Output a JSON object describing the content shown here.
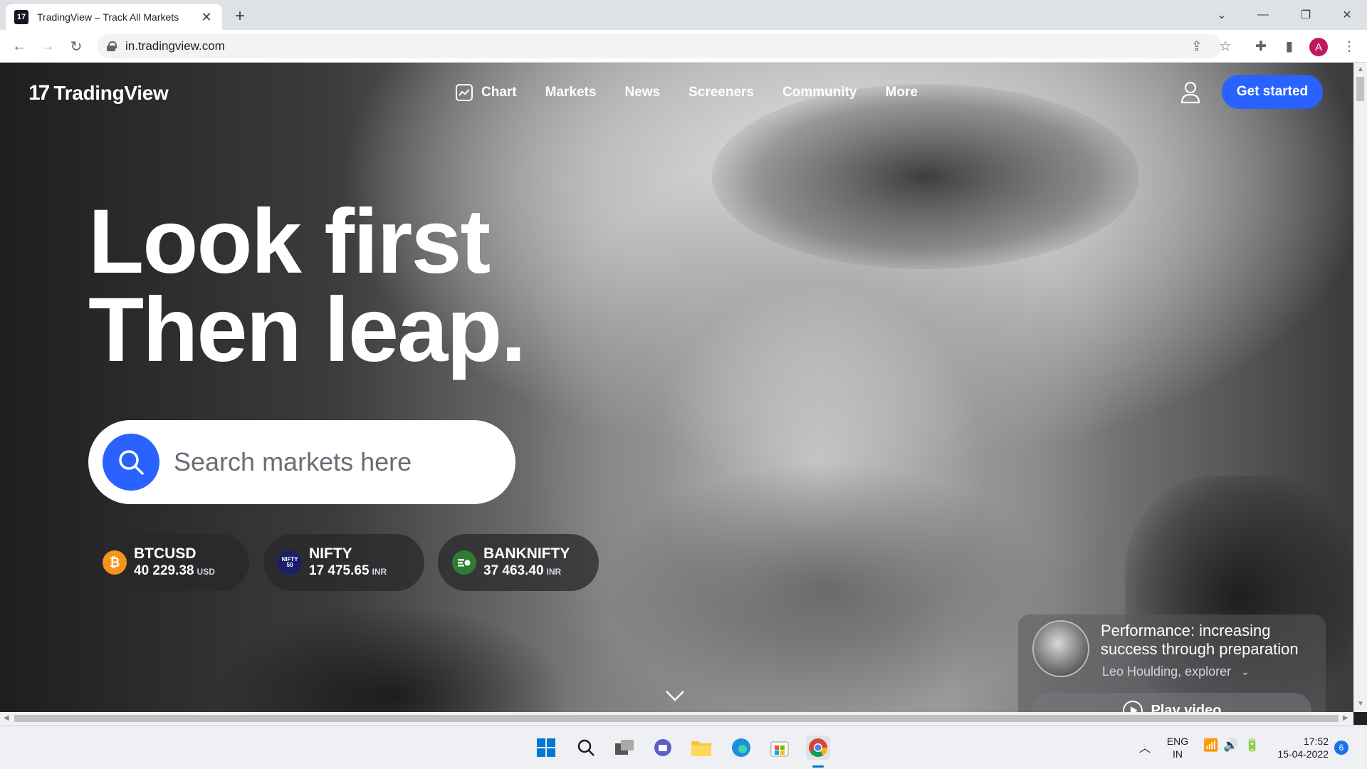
{
  "browser": {
    "tab_title": "TradingView – Track All Markets",
    "tab_favicon": "17",
    "url": "in.tradingview.com",
    "profile_initial": "A"
  },
  "site": {
    "logo_mark": "17",
    "logo_text": "TradingView",
    "nav": [
      "Chart",
      "Markets",
      "News",
      "Screeners",
      "Community",
      "More"
    ],
    "cta": "Get started"
  },
  "hero": {
    "line1": "Look first",
    "line2": "Then leap.",
    "search_placeholder": "Search markets here"
  },
  "tickers": [
    {
      "symbol": "BTCUSD",
      "value": "40 229.38",
      "currency": "USD",
      "icon": "₿",
      "color": "#f7931a"
    },
    {
      "symbol": "NIFTY",
      "value": "17 475.65",
      "currency": "INR",
      "icon": "NIFTY 50",
      "color": "#1b1f6b"
    },
    {
      "symbol": "BANKNIFTY",
      "value": "37 463.40",
      "currency": "INR",
      "icon": "bank-icon",
      "color": "#2e7d32"
    }
  ],
  "video": {
    "title": "Performance: increasing success through preparation",
    "author": "Leo Houlding, explorer",
    "play_label": "Play video"
  },
  "taskbar": {
    "lang1": "ENG",
    "lang2": "IN",
    "time": "17:52",
    "date": "15-04-2022",
    "notifications": "6"
  },
  "colors": {
    "accent": "#2962ff"
  }
}
